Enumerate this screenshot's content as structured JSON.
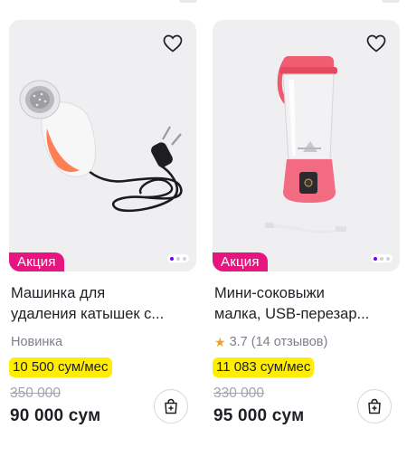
{
  "products": [
    {
      "promo_label": "Акция",
      "title_line1": "Машинка для",
      "title_line2": "удаления катышек с...",
      "meta": "Новинка",
      "installment": "10 500 сум/мес",
      "old_price": "350 000",
      "price": "90 000 сум"
    },
    {
      "promo_label": "Акция",
      "title_line1": "Мини-соковыжи",
      "title_line2": "малка, USB-перезар...",
      "rating": "3.7",
      "reviews": "(14 отзывов)",
      "installment": "11 083 сум/мес",
      "old_price": "330 000",
      "price": "95 000 сум"
    }
  ],
  "icons": {
    "favorite": "heart-outline-icon",
    "cart": "add-to-cart-bag-icon",
    "rating": "star-icon"
  },
  "colors": {
    "promo": "#e6157f",
    "installment_bg": "#ffee00",
    "carousel_active": "#7000ff",
    "star": "#f4a01c"
  }
}
